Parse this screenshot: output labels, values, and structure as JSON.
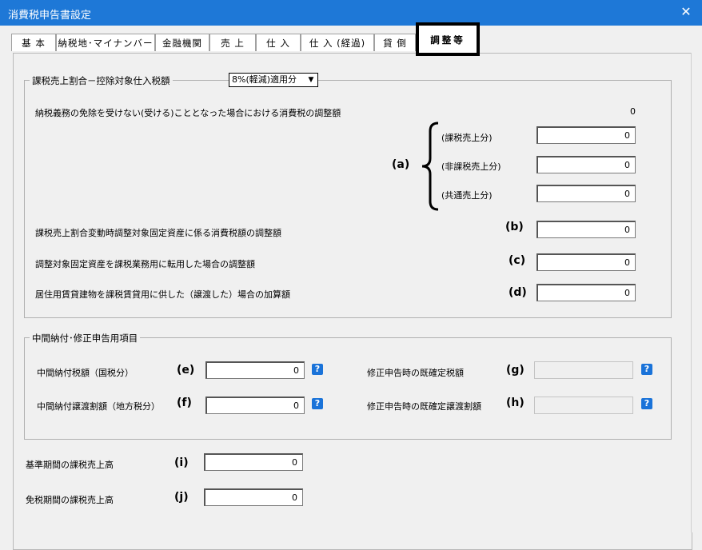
{
  "window": {
    "title": "消費税申告書設定",
    "close_glyph": "✕"
  },
  "tabs": [
    {
      "label": "基 本"
    },
    {
      "label": "納税地･マイナンバー等"
    },
    {
      "label": "金融機関"
    },
    {
      "label": "売 上"
    },
    {
      "label": "仕 入"
    },
    {
      "label": "仕 入 (経過)"
    },
    {
      "label": "貸 倒"
    },
    {
      "label": "調整等",
      "active": true
    }
  ],
  "adjustment_group": {
    "legend": "課税売上割合－控除対象仕入税額",
    "rate_select_value": "8%(軽減)適用分",
    "exemption_row": {
      "label": "納税義務の免除を受けない(受ける)こととなった場合における消費税の調整額",
      "value": "0"
    },
    "bracket_tag": "(a)",
    "bracket_rows": [
      {
        "label": "(課税売上分)",
        "value": "0"
      },
      {
        "label": "(非課税売上分)",
        "value": "0"
      },
      {
        "label": "(共通売上分)",
        "value": "0"
      }
    ],
    "rows": [
      {
        "label": "課税売上割合変動時調整対象固定資産に係る消費税額の調整額",
        "tag": "(b)",
        "value": "0"
      },
      {
        "label": "調整対象固定資産を課税業務用に転用した場合の調整額",
        "tag": "(c)",
        "value": "0"
      },
      {
        "label": "居住用賃貸建物を課税賃貸用に供した（譲渡した）場合の加算額",
        "tag": "(d)",
        "value": "0"
      }
    ]
  },
  "interim_group": {
    "legend": "中間納付･修正申告用項目",
    "left_rows": [
      {
        "label": "中間納付税額（国税分）",
        "tag": "(e)",
        "value": "0"
      },
      {
        "label": "中間納付譲渡割額（地方税分）",
        "tag": "(f)",
        "value": "0"
      }
    ],
    "right_rows": [
      {
        "label": "修正申告時の既確定税額",
        "tag": "(g)",
        "value": ""
      },
      {
        "label": "修正申告時の既確定譲渡割額",
        "tag": "(h)",
        "value": ""
      }
    ],
    "help_glyph": "?"
  },
  "bottom_rows": [
    {
      "label": "基準期間の課税売上高",
      "tag": "(i)",
      "value": "0"
    },
    {
      "label": "免税期間の課税売上高",
      "tag": "(j)",
      "value": "0"
    }
  ]
}
